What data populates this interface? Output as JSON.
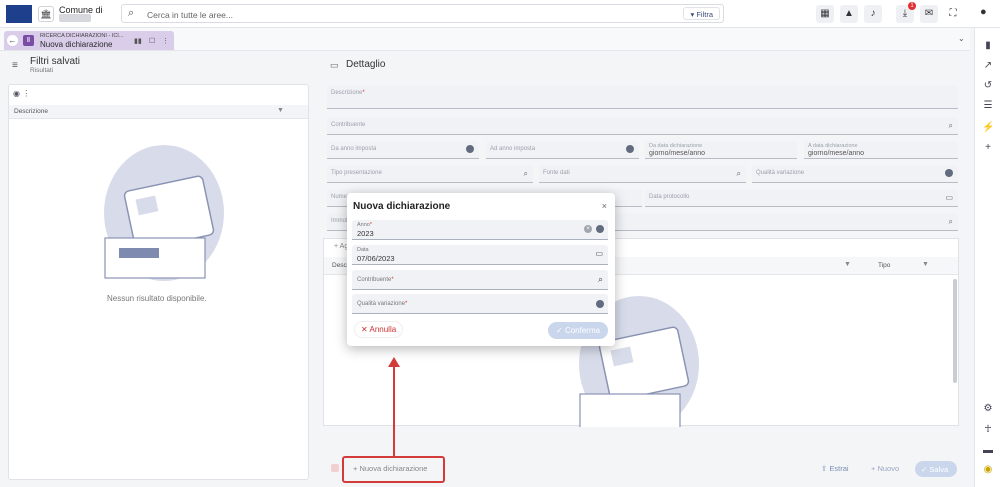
{
  "header": {
    "comune_label": "Comune di",
    "search_placeholder": "Cerca in tutte le aree...",
    "filter_label": "Filtra",
    "notif_count": "1"
  },
  "tab": {
    "small": "RICERCA DICHIARAZIONI - ICI...",
    "title": "Nuova dichiarazione"
  },
  "left_panel": {
    "title": "Filtri salvati",
    "subtitle": "Risultati",
    "column": "Descrizione",
    "empty": "Nessun risultato disponibile."
  },
  "detail": {
    "title": "Dettaglio",
    "descrizione": "Descrizione",
    "contribuente": "Contribuente",
    "da_anno": "Da anno imposta",
    "ad_anno": "Ad anno imposta",
    "da_data_label": "Da data dichiarazione",
    "a_data_label": "A data dichiarazione",
    "date_ph": "giorno/mese/anno",
    "tipo_pres": "Tipo presentazione",
    "fonte": "Fonte dati",
    "qualita": "Qualità variazione",
    "numero": "Numero",
    "data_prot": "Data protocollo",
    "immobile": "Immobile",
    "aggiungi": "+ Ag",
    "col_desc": "Descr",
    "col_tipo": "Tipo"
  },
  "dialog": {
    "title": "Nuova dichiarazione",
    "anno_label": "Anno",
    "anno_value": "2023",
    "data_label": "Data",
    "data_value": "07/06/2023",
    "contribuente_label": "Contribuente",
    "qualita_label": "Qualità variazione",
    "cancel": "Annulla",
    "confirm": "Conferma"
  },
  "footer": {
    "new_decl": "Nuova dichiarazione",
    "estrai": "Estrai",
    "nuovo": "Nuovo",
    "salva": "Salva"
  },
  "colors": {
    "accent": "#d33b3b",
    "tab": "#d9cde9",
    "brand": "#1e3f8c"
  }
}
